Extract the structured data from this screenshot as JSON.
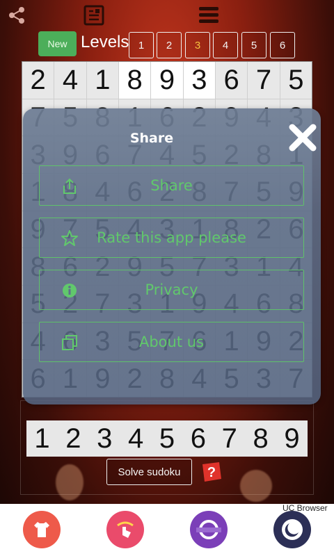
{
  "top_bar": {
    "icons": [
      "share-icon",
      "book-icon",
      "menu-icon"
    ]
  },
  "levels": {
    "new_label": "New",
    "label": "Levels",
    "buttons": [
      "1",
      "2",
      "3",
      "4",
      "5",
      "6"
    ],
    "selected": "3"
  },
  "grid": {
    "rows": [
      [
        "2",
        "4",
        "1",
        "8",
        "9",
        "3",
        "6",
        "7",
        "5"
      ],
      [
        "7",
        "5",
        "8",
        "1",
        "6",
        "2",
        "9",
        "4",
        "3"
      ],
      [
        "3",
        "9",
        "6",
        "7",
        "4",
        "5",
        "2",
        "8",
        "1"
      ],
      [
        "1",
        "8",
        "4",
        "6",
        "2",
        "8",
        "7",
        "5",
        "9"
      ],
      [
        "9",
        "7",
        "5",
        "4",
        "3",
        "1",
        "8",
        "2",
        "6"
      ],
      [
        "8",
        "6",
        "2",
        "9",
        "5",
        "7",
        "3",
        "1",
        "4"
      ],
      [
        "5",
        "2",
        "7",
        "3",
        "1",
        "9",
        "4",
        "6",
        "8"
      ],
      [
        "4",
        "6",
        "3",
        "5",
        "7",
        "6",
        "1",
        "9",
        "2"
      ],
      [
        "6",
        "1",
        "9",
        "2",
        "8",
        "4",
        "5",
        "3",
        "7"
      ]
    ]
  },
  "numpad": {
    "keys": [
      "1",
      "2",
      "3",
      "4",
      "5",
      "6",
      "7",
      "8",
      "9"
    ]
  },
  "solve_label": "Solve sudoku",
  "dialog": {
    "title": "Share",
    "items": [
      {
        "label": "Share",
        "icon": "upload-icon"
      },
      {
        "label": "Rate this app please",
        "icon": "star-icon"
      },
      {
        "label": "Privacy",
        "icon": "info-icon"
      },
      {
        "label": "About us",
        "icon": "copy-icon"
      }
    ]
  },
  "ad_bar": {
    "label": "UC Browser",
    "icons": [
      "shirt-app-icon",
      "hand-tap-app-icon",
      "circle-app-icon",
      "moon-app-icon"
    ]
  },
  "colors": {
    "new_button": "#4cae5a",
    "selected_level": "#f6c441",
    "dialog_accent": "#61c86c",
    "dialog_bg": "#5e6f8b"
  }
}
